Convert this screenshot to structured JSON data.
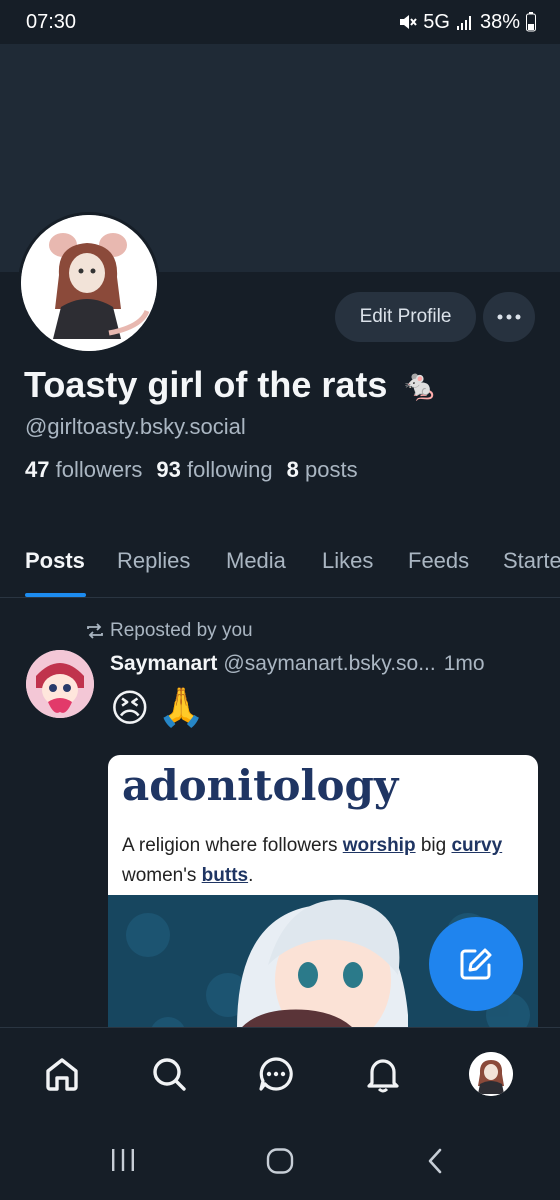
{
  "status_bar": {
    "time": "07:30",
    "network": "5G",
    "battery": "38%"
  },
  "profile": {
    "display_name": "Toasty girl of the rats",
    "name_emoji": "🐁",
    "handle": "@girltoasty.bsky.social",
    "edit_button": "Edit Profile",
    "stats": {
      "followers_count": "47",
      "followers_label": "followers",
      "following_count": "93",
      "following_label": "following",
      "posts_count": "8",
      "posts_label": "posts"
    }
  },
  "tabs": [
    "Posts",
    "Replies",
    "Media",
    "Likes",
    "Feeds",
    "Starter"
  ],
  "active_tab": "Posts",
  "post": {
    "repost_label": "Reposted by you",
    "author": "Saymanart",
    "handle": "@saymanart.bsky.so...",
    "time": "1mo",
    "emojis": [
      "😣",
      "🙏"
    ],
    "image": {
      "word": "adonitology",
      "definition_parts": [
        "A religion where followers ",
        "worship",
        " big ",
        "curvy",
        " women's ",
        "butts",
        "."
      ]
    }
  },
  "icons": {
    "fab": "compose-icon",
    "nav": [
      "home-icon",
      "search-icon",
      "chat-icon",
      "bell-icon",
      "avatar"
    ],
    "system": [
      "recents-icon",
      "home-circle-icon",
      "back-icon"
    ]
  },
  "colors": {
    "background": "#161e27",
    "banner": "#1f2a36",
    "accent": "#1d8cf0",
    "fab": "#1f84ee"
  }
}
